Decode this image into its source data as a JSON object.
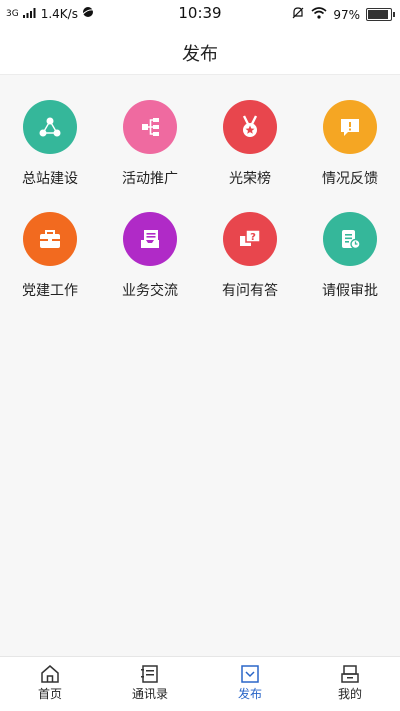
{
  "status_bar": {
    "network": "3G",
    "speed": "1.4K/s",
    "time": "10:39",
    "battery": "97%"
  },
  "header": {
    "title": "发布"
  },
  "grid_items": [
    {
      "label": "总站建设",
      "color": "#35b79a",
      "icon": "share-icon"
    },
    {
      "label": "活动推广",
      "color": "#ef6aa0",
      "icon": "hierarchy-icon"
    },
    {
      "label": "光荣榜",
      "color": "#e8464d",
      "icon": "medal-icon"
    },
    {
      "label": "情况反馈",
      "color": "#f5a623",
      "icon": "alert-message-icon"
    },
    {
      "label": "党建工作",
      "color": "#f26a1f",
      "icon": "briefcase-icon"
    },
    {
      "label": "业务交流",
      "color": "#b02ac7",
      "icon": "inbox-icon"
    },
    {
      "label": "有问有答",
      "color": "#e8464d",
      "icon": "question-chat-icon"
    },
    {
      "label": "请假审批",
      "color": "#35b79a",
      "icon": "form-clock-icon"
    }
  ],
  "tabbar": [
    {
      "label": "首页",
      "icon": "home-icon",
      "active": false
    },
    {
      "label": "通讯录",
      "icon": "contacts-icon",
      "active": false
    },
    {
      "label": "发布",
      "icon": "publish-icon",
      "active": true
    },
    {
      "label": "我的",
      "icon": "profile-icon",
      "active": false
    }
  ]
}
